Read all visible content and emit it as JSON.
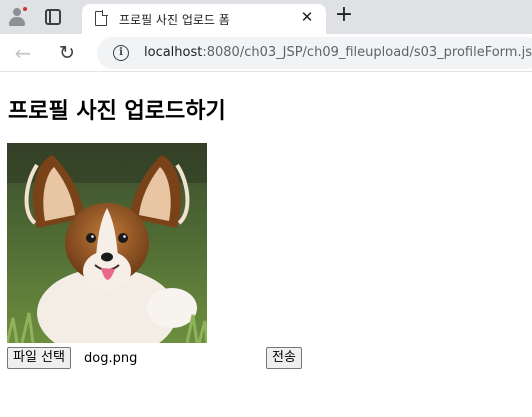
{
  "browser": {
    "tab_title": "프로필 사진 업로드 폼",
    "tab_close": "✕",
    "new_tab": "+",
    "url_host": "localhost",
    "url_path": ":8080/ch03_JSP/ch09_fileupload/s03_profileForm.jsp",
    "icons": {
      "profile": "profile-avatar-icon",
      "tab_strip": "tab-strip-icon",
      "page": "page-document-icon",
      "back": "back-arrow-icon",
      "reload": "reload-icon",
      "site_info": "info-icon"
    }
  },
  "page": {
    "heading": "프로필 사진 업로드하기",
    "image_alt": "dog profile photo (papillon)",
    "file_button_label": "파일 선택",
    "file_name": "dog.png",
    "submit_label": "전송"
  },
  "colors": {
    "tabbar_bg": "#dfe1e5",
    "omnibox_bg": "#f1f3f4",
    "notification_dot": "#d93025"
  }
}
